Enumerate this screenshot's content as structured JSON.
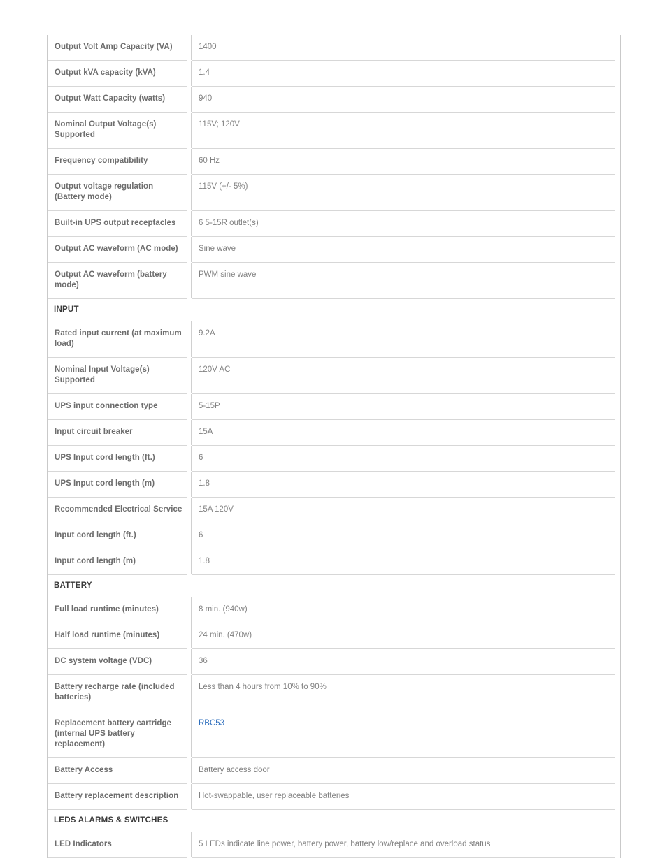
{
  "spec_table": {
    "link_color": "#2f6fbd",
    "label_color": "#6d6d6d",
    "value_color": "#828282",
    "section_header_color": "#3a3a3a",
    "rows": [
      {
        "kind": "spec",
        "label": "Output Volt Amp Capacity (VA)",
        "value": "1400"
      },
      {
        "kind": "spec",
        "label": "Output kVA capacity (kVA)",
        "value": "1.4"
      },
      {
        "kind": "spec",
        "label": "Output Watt Capacity (watts)",
        "value": "940"
      },
      {
        "kind": "spec",
        "label": "Nominal Output Voltage(s) Supported",
        "value": "115V; 120V"
      },
      {
        "kind": "spec",
        "label": "Frequency compatibility",
        "value": "60 Hz"
      },
      {
        "kind": "spec",
        "label": "Output voltage regulation (Battery mode)",
        "value": "115V (+/- 5%)"
      },
      {
        "kind": "spec",
        "label": "Built-in UPS output receptacles",
        "value": "6 5-15R outlet(s)"
      },
      {
        "kind": "spec",
        "label": "Output AC waveform (AC mode)",
        "value": "Sine wave"
      },
      {
        "kind": "spec",
        "label": "Output AC waveform (battery mode)",
        "value": "PWM sine wave"
      },
      {
        "kind": "section",
        "label": "INPUT"
      },
      {
        "kind": "spec",
        "label": "Rated input current (at maximum load)",
        "value": "9.2A"
      },
      {
        "kind": "spec",
        "label": "Nominal Input Voltage(s) Supported",
        "value": "120V AC"
      },
      {
        "kind": "spec",
        "label": "UPS input connection type",
        "value": "5-15P"
      },
      {
        "kind": "spec",
        "label": "Input circuit breaker",
        "value": "15A"
      },
      {
        "kind": "spec",
        "label": "UPS Input cord length (ft.)",
        "value": "6"
      },
      {
        "kind": "spec",
        "label": "UPS Input cord length (m)",
        "value": "1.8"
      },
      {
        "kind": "spec",
        "label": "Recommended Electrical Service",
        "value": "15A 120V"
      },
      {
        "kind": "spec",
        "label": "Input cord length (ft.)",
        "value": "6"
      },
      {
        "kind": "spec",
        "label": "Input cord length (m)",
        "value": "1.8"
      },
      {
        "kind": "section",
        "label": "BATTERY"
      },
      {
        "kind": "spec",
        "label": "Full load runtime (minutes)",
        "value": "8 min. (940w)"
      },
      {
        "kind": "spec",
        "label": "Half load runtime (minutes)",
        "value": "24 min. (470w)"
      },
      {
        "kind": "spec",
        "label": "DC system voltage (VDC)",
        "value": "36"
      },
      {
        "kind": "spec",
        "label": "Battery recharge rate (included batteries)",
        "value": "Less than 4 hours from 10% to 90%"
      },
      {
        "kind": "spec",
        "label": "Replacement battery cartridge (internal UPS battery replacement)",
        "value": "RBC53",
        "value_is_link": true
      },
      {
        "kind": "spec",
        "label": "Battery Access",
        "value": "Battery access door"
      },
      {
        "kind": "spec",
        "label": "Battery replacement description",
        "value": "Hot-swappable, user replaceable batteries"
      },
      {
        "kind": "section",
        "label": "LEDS ALARMS & SWITCHES"
      },
      {
        "kind": "spec",
        "label": "LED Indicators",
        "value": "5 LEDs indicate line power, battery power, battery low/replace and overload status"
      }
    ]
  }
}
